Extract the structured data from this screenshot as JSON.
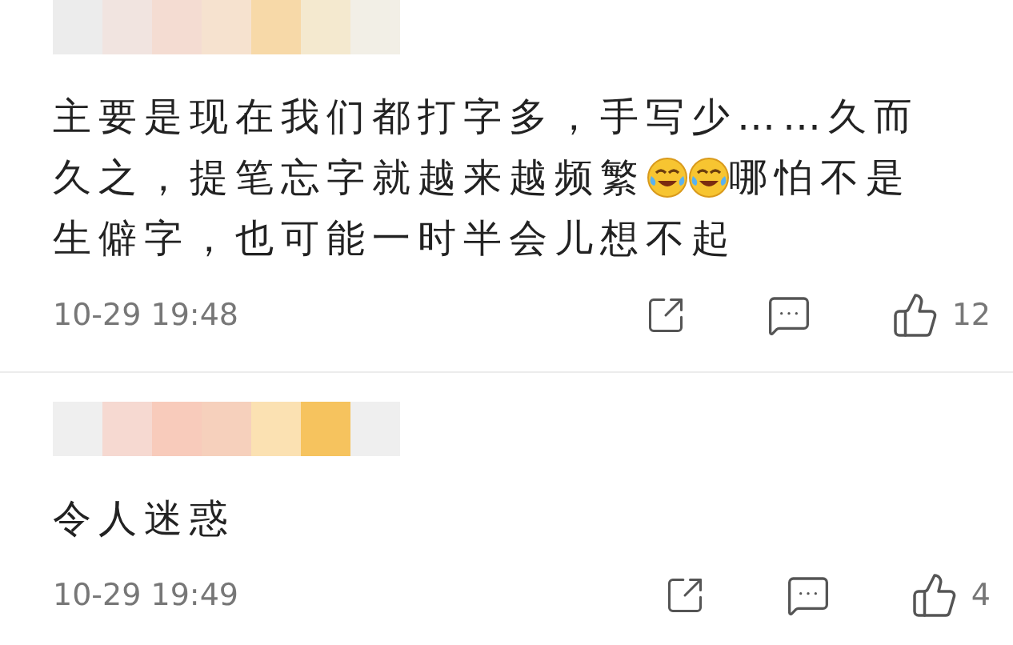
{
  "comments": [
    {
      "lines": [
        [
          {
            "kind": "text",
            "text": "主要是现在我们都打字多，手写少……久而"
          }
        ],
        [
          {
            "kind": "text",
            "text": "久之，提笔忘字就越来越频繁"
          },
          {
            "kind": "emoji"
          },
          {
            "kind": "emoji"
          },
          {
            "kind": "text",
            "text": "哪怕不是"
          }
        ],
        [
          {
            "kind": "text",
            "text": "生僻字，也可能一时半会儿想不起"
          }
        ]
      ],
      "time": "10-29 19:48",
      "likes": "12"
    },
    {
      "lines": [
        [
          {
            "kind": "text",
            "text": "令人迷惑"
          }
        ]
      ],
      "time": "10-29 19:49",
      "likes": "4"
    }
  ]
}
